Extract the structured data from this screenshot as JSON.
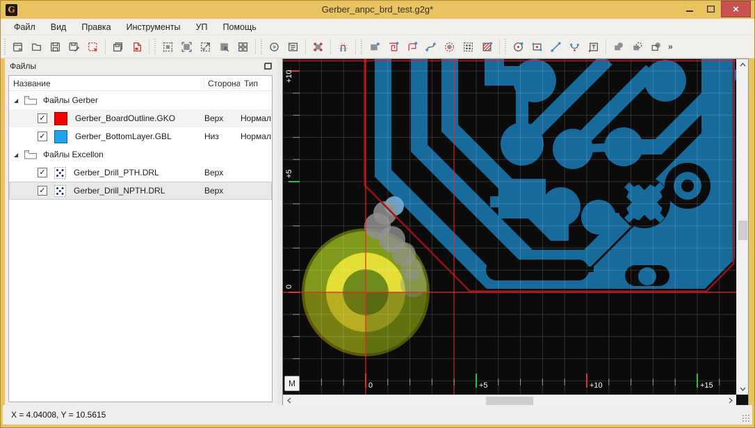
{
  "window": {
    "title": "Gerber_anpc_brd_test.g2g*",
    "app_icon_glyph": "G",
    "close_glyph": "×"
  },
  "menu": {
    "items": [
      "Файл",
      "Вид",
      "Правка",
      "Инструменты",
      "УП",
      "Помощь"
    ]
  },
  "toolbar": {
    "overflow_glyph": "»",
    "icons": [
      "new-file",
      "open-file",
      "save-file",
      "save-file-as",
      "close-file",
      "save-all",
      "export-file",
      "zoom-selection",
      "zoom-extents",
      "zoom-out-selection",
      "zoom-in-selection",
      "tile-windows",
      "run-settings",
      "properties-list",
      "edit-vertices",
      "snap-magnet",
      "aperture-pad",
      "polygon-region",
      "polygon-rounded",
      "draw-path",
      "flash-aperture",
      "drill-pattern",
      "hatch-region",
      "draw-circle",
      "draw-rectangle",
      "draw-line",
      "draw-arc",
      "draw-text",
      "boolean-union",
      "boolean-subtract",
      "boolean-intersect"
    ]
  },
  "files_panel": {
    "title": "Файлы",
    "check_glyph": "✓",
    "expander_glyph": "◢",
    "columns": [
      "Название",
      "Сторона",
      "Тип"
    ],
    "groups": [
      {
        "label": "Файлы Gerber",
        "rows": [
          {
            "name": "Gerber_BoardOutline.GKO",
            "side": "Верх",
            "type": "Нормал...",
            "color": "#f20000",
            "checked": true
          },
          {
            "name": "Gerber_BottomLayer.GBL",
            "side": "Низ",
            "type": "Нормал...",
            "color": "#1ea2f0",
            "checked": true
          }
        ]
      },
      {
        "label": "Файлы Excellon",
        "rows": [
          {
            "name": "Gerber_Drill_PTH.DRL",
            "side": "Верх",
            "type": "",
            "checked": true
          },
          {
            "name": "Gerber_Drill_NPTH.DRL",
            "side": "Верх",
            "type": "",
            "checked": true,
            "selected": true
          }
        ]
      }
    ]
  },
  "canvas": {
    "units_button": "M",
    "x_ruler_labels": [
      {
        "text": "0"
      },
      {
        "text": "+5"
      },
      {
        "text": "+10"
      },
      {
        "text": "+15"
      }
    ],
    "y_ruler_labels": [
      {
        "text": "+10"
      },
      {
        "text": "+5"
      },
      {
        "text": "0"
      }
    ]
  },
  "status_bar": {
    "coordinates": "X = 4.04008, Y = 10.5615"
  },
  "theme": {
    "titlebar": "#e9c35f",
    "close_btn": "#c85250",
    "canvas_bg": "#0b0b0b",
    "copper": "#166a9c",
    "outline": "#9e1116",
    "crosshair": "#e02424",
    "flash_olive": "#7f9a1b",
    "flash_yellow": "#e2de33",
    "flash_green": "#6d8c1b",
    "tick_major_red": "#e03030",
    "tick_major_green": "#2fc040"
  }
}
